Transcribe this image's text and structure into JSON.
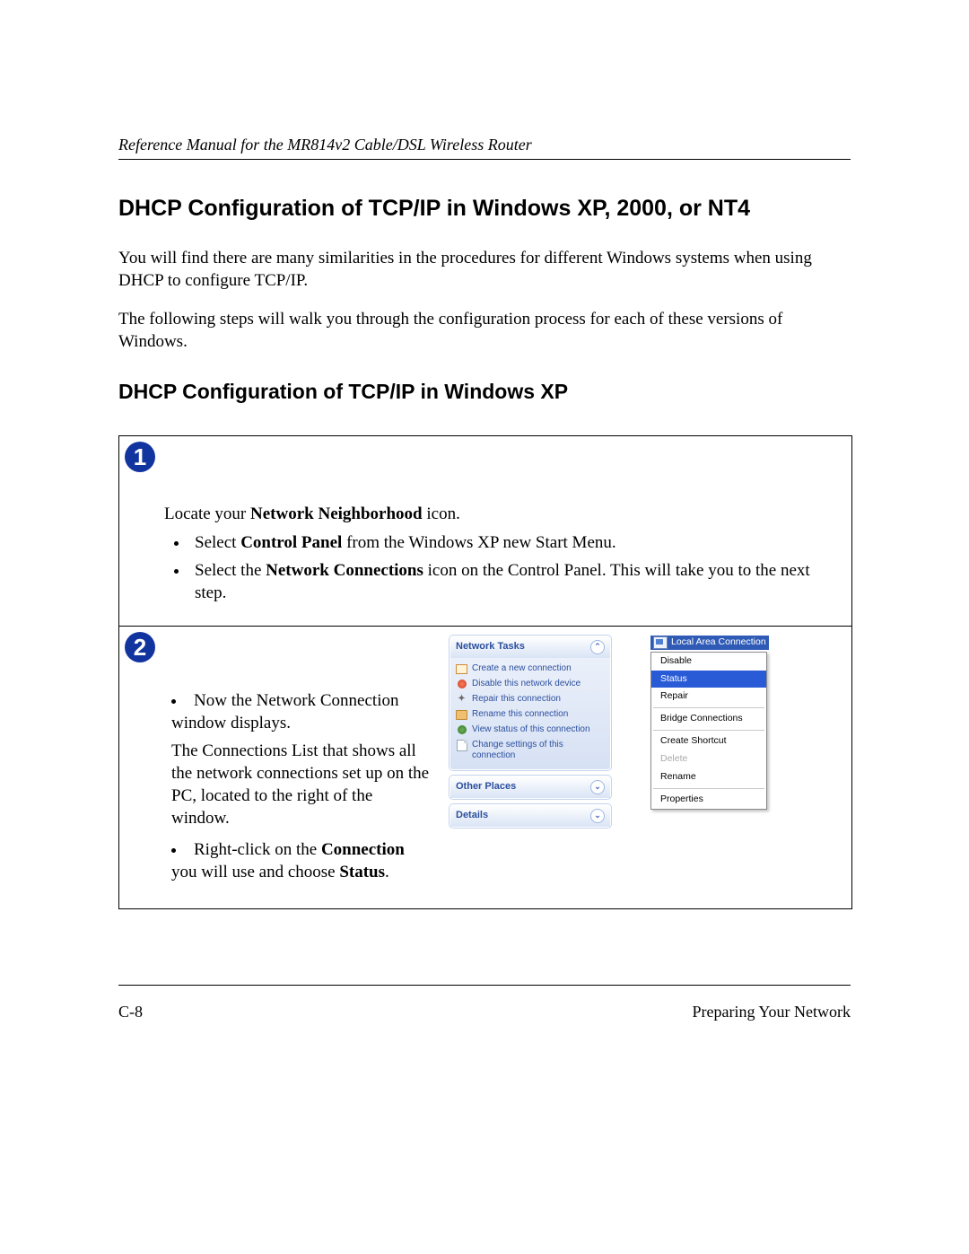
{
  "running_head": "Reference Manual for the MR814v2 Cable/DSL Wireless Router",
  "h1": "DHCP Configuration of TCP/IP in Windows XP, 2000, or NT4",
  "p1": "You will find there are many similarities in the procedures for different Windows systems when using DHCP to configure TCP/IP.",
  "p2": "The following steps will walk you through the configuration process for each of these versions of Windows.",
  "h2": "DHCP Configuration of TCP/IP in Windows XP",
  "step1": {
    "num": "1",
    "lead_pre": "Locate your ",
    "lead_bold": "Network Neighborhood",
    "lead_post": " icon.",
    "b1_pre": "Select ",
    "b1_bold": "Control Panel",
    "b1_post": " from the Windows XP new Start Menu.",
    "b2_pre": "Select the ",
    "b2_bold": "Network Connections",
    "b2_post": " icon on the Control Panel.  This will take you to the next step."
  },
  "step2": {
    "num": "2",
    "left_b1": "Now the Network Connection window displays.",
    "left_b1_p": "The Connections List that shows all the network connections set up on the PC, located to the right of the window.",
    "left_b2_pre": "Right-click on the ",
    "left_b2_bold1": "Connection",
    "left_b2_mid": " you will use and choose ",
    "left_b2_bold2": "Status",
    "left_b2_post": "."
  },
  "xp": {
    "group1_title": "Network Tasks",
    "tasks": [
      "Create a new connection",
      "Disable this network device",
      "Repair this connection",
      "Rename this connection",
      "View status of this connection",
      "Change settings of this connection"
    ],
    "group2_title": "Other Places",
    "group3_title": "Details",
    "lan_label": "Local Area Connection",
    "menu": {
      "disable": "Disable",
      "status": "Status",
      "repair": "Repair",
      "bridge": "Bridge Connections",
      "shortcut": "Create Shortcut",
      "delete": "Delete",
      "rename": "Rename",
      "properties": "Properties"
    }
  },
  "footer_left": "C-8",
  "footer_right": "Preparing Your Network"
}
